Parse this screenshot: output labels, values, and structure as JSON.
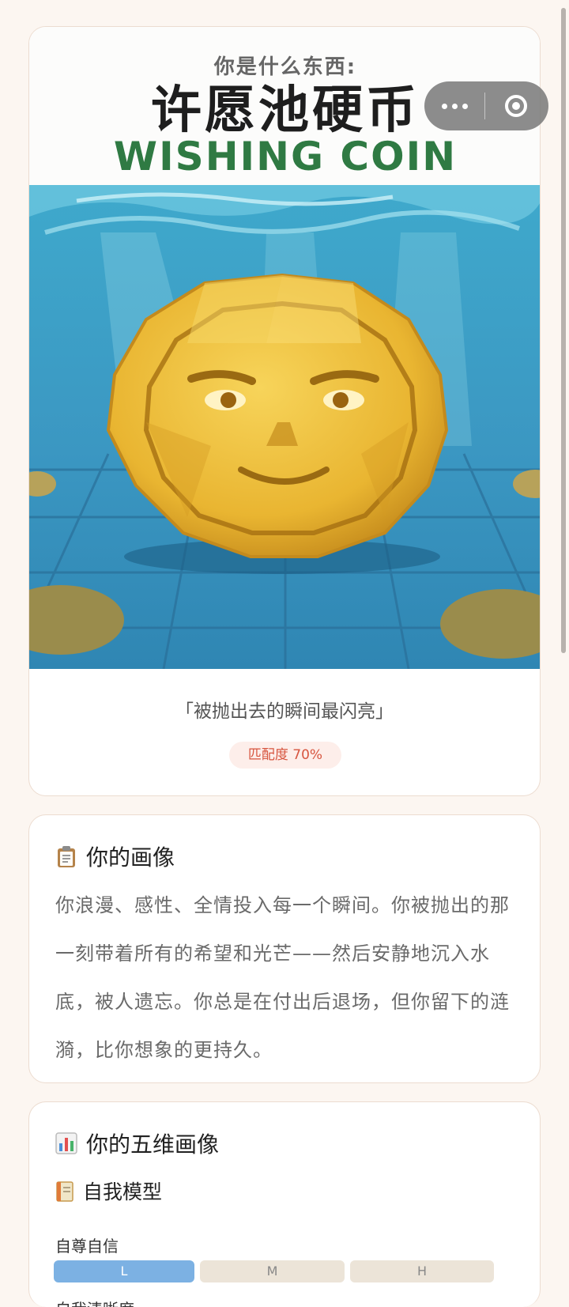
{
  "poster": {
    "question": "你是什么东西:",
    "title_cn": "许愿池硬币",
    "title_en": "WISHING COIN",
    "colors": {
      "title_en": "#2f7a43",
      "water": "#3aa0c4",
      "coin": "#e9b531"
    }
  },
  "result": {
    "quote": "「被抛出去的瞬间最闪亮」",
    "match": "匹配度 70%"
  },
  "profile": {
    "icon": "clipboard-icon",
    "title": "你的画像",
    "text": "你浪漫、感性、全情投入每一个瞬间。你被抛出的那一刻带着所有的希望和光芒——然后安静地沉入水底，被人遗忘。你总是在付出后退场，但你留下的涟漪，比你想象的更持久。"
  },
  "dimensions": {
    "icon": "bar-chart-icon",
    "title": "你的五维画像",
    "self_model": {
      "icon": "notebook-icon",
      "title": "自我模型",
      "metric1": {
        "label": "自尊自信",
        "levels": [
          "L",
          "M",
          "H"
        ],
        "selected": "L"
      },
      "metric2_label": "自我清晰度"
    }
  },
  "capsule": {
    "more_icon": "more-dots-icon",
    "close_icon": "target-close-icon"
  }
}
